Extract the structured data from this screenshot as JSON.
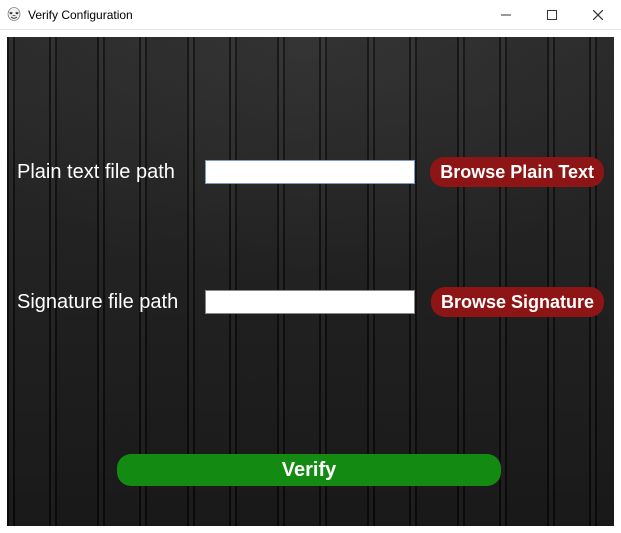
{
  "window": {
    "title": "Verify Configuration",
    "icon": "mask-icon"
  },
  "fields": {
    "plain": {
      "label": "Plain text file path",
      "value": "",
      "browse_label": "Browse Plain Text"
    },
    "signature": {
      "label": "Signature file path",
      "value": "",
      "browse_label": "Browse Signature"
    }
  },
  "actions": {
    "verify_label": "Verify"
  },
  "colors": {
    "browse_bg": "#8d1515",
    "verify_bg": "#138b13"
  }
}
